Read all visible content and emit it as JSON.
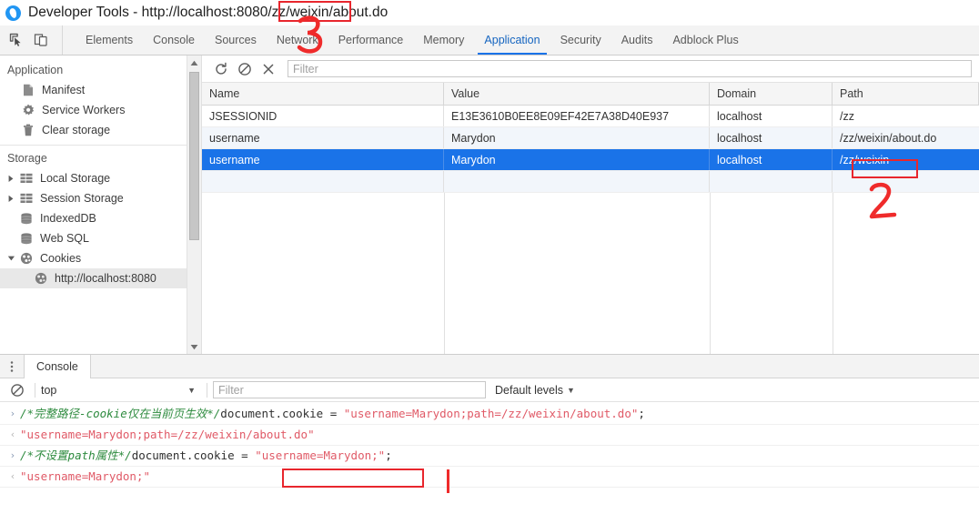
{
  "titlebar": {
    "icon": "chrome-devtools-logo",
    "text": "Developer Tools - http://localhost:8080/zz/weixin/about.do"
  },
  "toolbar": {
    "icons": [
      {
        "name": "inspect-element-icon",
        "label": "Inspect element"
      },
      {
        "name": "device-toolbar-icon",
        "label": "Toggle device toolbar"
      }
    ],
    "tabs": [
      {
        "label": "Elements",
        "active": false
      },
      {
        "label": "Console",
        "active": false
      },
      {
        "label": "Sources",
        "active": false
      },
      {
        "label": "Network",
        "active": false
      },
      {
        "label": "Performance",
        "active": false
      },
      {
        "label": "Memory",
        "active": false
      },
      {
        "label": "Application",
        "active": true
      },
      {
        "label": "Security",
        "active": false
      },
      {
        "label": "Audits",
        "active": false
      },
      {
        "label": "Adblock Plus",
        "active": false
      }
    ]
  },
  "sidebar": {
    "sections": [
      {
        "title": "Application",
        "items": [
          {
            "label": "Manifest",
            "icon": "manifest-file-icon",
            "twisty": "",
            "selected": false
          },
          {
            "label": "Service Workers",
            "icon": "gear-icon",
            "twisty": "",
            "selected": false
          },
          {
            "label": "Clear storage",
            "icon": "trash-icon",
            "twisty": "",
            "selected": false
          }
        ]
      },
      {
        "title": "Storage",
        "items": [
          {
            "label": "Local Storage",
            "icon": "table-grid-icon",
            "twisty": "right",
            "selected": false
          },
          {
            "label": "Session Storage",
            "icon": "table-grid-icon",
            "twisty": "right",
            "selected": false
          },
          {
            "label": "IndexedDB",
            "icon": "database-icon",
            "twisty": "",
            "selected": false
          },
          {
            "label": "Web SQL",
            "icon": "database-icon",
            "twisty": "",
            "selected": false
          },
          {
            "label": "Cookies",
            "icon": "cookie-icon",
            "twisty": "down",
            "selected": false
          },
          {
            "label": "http://localhost:8080",
            "icon": "cookie-icon",
            "twisty": "",
            "selected": true
          }
        ]
      }
    ],
    "scrollbar": {
      "up": "▲",
      "down": "▼"
    }
  },
  "cookie_toolbar": {
    "icons": [
      {
        "name": "refresh-icon"
      },
      {
        "name": "clear-all-cookies-icon"
      },
      {
        "name": "delete-cookie-icon"
      }
    ],
    "filter_placeholder": "Filter",
    "filter_value": ""
  },
  "cookie_table": {
    "columns": [
      "Name",
      "Value",
      "Domain",
      "Path"
    ],
    "rows": [
      {
        "name": "JSESSIONID",
        "value": "E13E3610B0EE8E09EF42E7A38D40E937",
        "domain": "localhost",
        "path": "/zz",
        "selected": false
      },
      {
        "name": "username",
        "value": "Marydon",
        "domain": "localhost",
        "path": "/zz/weixin/about.do",
        "selected": false
      },
      {
        "name": "username",
        "value": "Marydon",
        "domain": "localhost",
        "path": "/zz/weixin",
        "selected": true
      }
    ]
  },
  "drawer": {
    "kebab_icon": "more-options-icon",
    "tab_label": "Console",
    "toolbar": {
      "clear_icon": "clear-console-icon",
      "context": "top",
      "context_caret": "▼",
      "filter_placeholder": "Filter",
      "filter_value": "",
      "levels_label": "Default levels",
      "levels_caret": "▼"
    },
    "log": [
      {
        "type": "input",
        "marker": "›",
        "tokens": [
          {
            "cls": "tk-comment",
            "t": "/*完整路径-cookie仅在当前页生效*/"
          },
          {
            "cls": "tk-plain",
            "t": "document.cookie "
          },
          {
            "cls": "tk-op",
            "t": "= "
          },
          {
            "cls": "tk-string",
            "t": "\"username=Marydon;path=/zz/weixin/about.do\""
          },
          {
            "cls": "tk-plain",
            "t": ";"
          }
        ]
      },
      {
        "type": "output",
        "marker": "‹",
        "tokens": [
          {
            "cls": "tk-out",
            "t": "\"username=Marydon;path=/zz/weixin/about.do\""
          }
        ]
      },
      {
        "type": "input",
        "marker": "›",
        "tokens": [
          {
            "cls": "tk-comment",
            "t": "/*不设置path属性*/"
          },
          {
            "cls": "tk-plain",
            "t": "document.cookie "
          },
          {
            "cls": "tk-op",
            "t": "= "
          },
          {
            "cls": "tk-string",
            "t": "\"username=Marydon;\""
          },
          {
            "cls": "tk-plain",
            "t": ";"
          }
        ]
      },
      {
        "type": "output",
        "marker": "‹",
        "tokens": [
          {
            "cls": "tk-out",
            "t": "\"username=Marydon;\""
          }
        ]
      }
    ]
  },
  "annotations": {
    "color": "#ef2b2b",
    "items": [
      {
        "kind": "box",
        "target": "title-path-segment",
        "text": ""
      },
      {
        "kind": "number",
        "target": "network-tab",
        "text": "3"
      },
      {
        "kind": "box",
        "target": "selected-row-path-cell",
        "text": ""
      },
      {
        "kind": "number",
        "target": "below-path-cell",
        "text": "2"
      },
      {
        "kind": "box",
        "target": "console-cookie-string",
        "text": ""
      },
      {
        "kind": "tick",
        "target": "console-caret-mark",
        "text": ""
      }
    ]
  }
}
